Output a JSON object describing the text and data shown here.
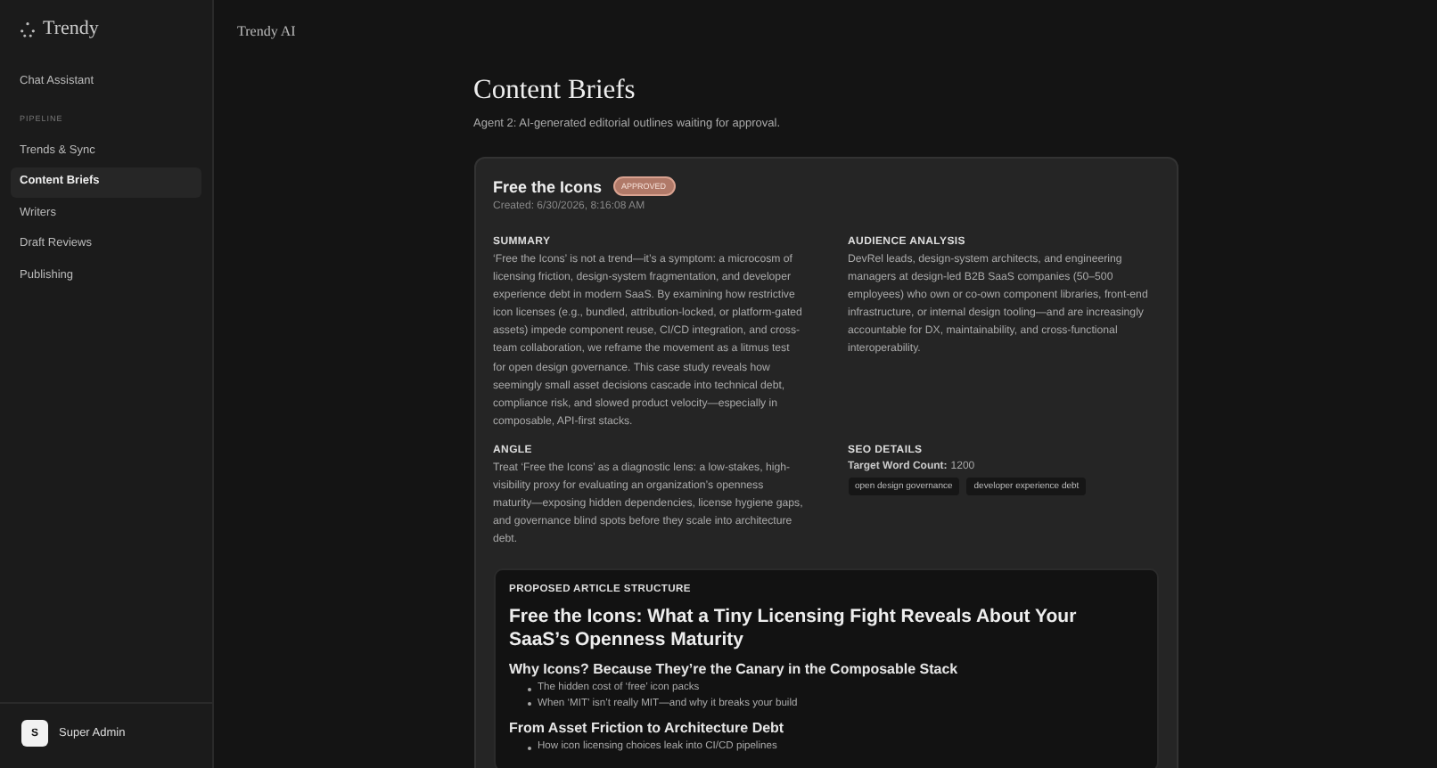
{
  "sidebar": {
    "logo": "Trendy",
    "items": [
      {
        "label": "Chat Assistant",
        "selected": false
      }
    ],
    "section_label": "PIPELINE",
    "pipeline_items": [
      {
        "label": "Trends & Sync",
        "selected": false
      },
      {
        "label": "Content Briefs",
        "selected": true
      },
      {
        "label": "Writers",
        "selected": false
      },
      {
        "label": "Draft Reviews",
        "selected": false
      },
      {
        "label": "Publishing",
        "selected": false
      }
    ],
    "user": {
      "initial": "S",
      "name": "Super Admin"
    }
  },
  "header": {
    "title": "Trendy AI"
  },
  "page": {
    "title": "Content Briefs",
    "subtitle": "Agent 2: AI-generated editorial outlines waiting for approval."
  },
  "brief": {
    "title": "Free the Icons",
    "status": "APPROVED",
    "created": "Created: 6/30/2026, 8:16:08 AM",
    "summary": {
      "label": "SUMMARY",
      "text": "‘Free the Icons’ is not a trend—it’s a symptom: a microcosm of licensing friction, design-system fragmentation, and developer experience debt in modern SaaS. By examining how restrictive icon licenses (e.g., bundled, attribution-locked, or platform-gated assets) impede component reuse, CI/CD integration, and cross-team collaboration, we reframe the movement as a litmus test for open design governance. This case study reveals how seemingly small asset decisions cascade into technical debt, compliance risk, and slowed product velocity—especially in composable, API-first stacks."
    },
    "audience": {
      "label": "AUDIENCE ANALYSIS",
      "text": "DevRel leads, design-system architects, and engineering managers at design-led B2B SaaS companies (50–500 employees) who own or co-own component libraries, front-end infrastructure, or internal design tooling—and are increasingly accountable for DX, maintainability, and cross-functional interoperability."
    },
    "angle": {
      "label": "ANGLE",
      "text": "Treat ‘Free the Icons’ as a diagnostic lens: a low-stakes, high-visibility proxy for evaluating an organization’s openness maturity—exposing hidden dependencies, license hygiene gaps, and governance blind spots before they scale into architecture debt."
    },
    "seo": {
      "label": "SEO DETAILS",
      "word_count_label": "Target Word Count:",
      "word_count": "1200",
      "keywords": [
        "open design governance",
        "developer experience debt"
      ]
    },
    "structure": {
      "label": "PROPOSED ARTICLE STRUCTURE",
      "title": "Free the Icons: What a Tiny Licensing Fight Reveals About Your SaaS’s Openness Maturity",
      "sections": [
        {
          "heading": "Why Icons? Because They’re the Canary in the Composable Stack",
          "bullets": [
            "The hidden cost of ‘free’ icon packs",
            "When ‘MIT’ isn’t really MIT—and why it breaks your build"
          ]
        },
        {
          "heading": "From Asset Friction to Architecture Debt",
          "bullets": [
            "How icon licensing choices leak into CI/CD pipelines"
          ]
        }
      ]
    }
  }
}
